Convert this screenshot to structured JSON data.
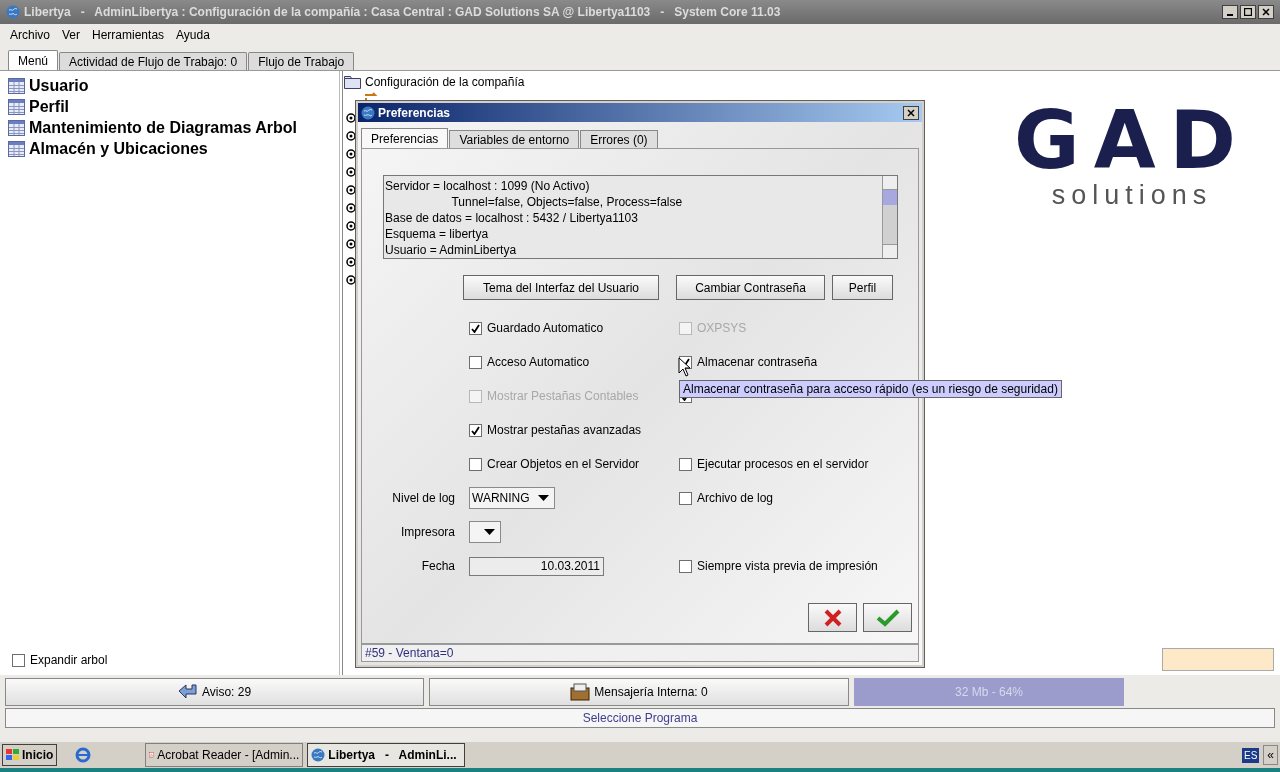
{
  "window": {
    "title": "Libertya   -   AdminLibertya : Configuración de la compañía : Casa Central : GAD Solutions SA @ Libertya1103   -   System Core 11.03"
  },
  "menu": [
    "Archivo",
    "Ver",
    "Herramientas",
    "Ayuda"
  ],
  "tabs": [
    {
      "label": "Menú",
      "selected": true
    },
    {
      "label": "Actividad de Flujo de Trabajo: 0",
      "selected": false
    },
    {
      "label": "Flujo de Trabajo",
      "selected": false
    }
  ],
  "sidebar": {
    "items": [
      "Usuario",
      "Perfil",
      "Mantenimiento de Diagramas Arbol",
      "Almacén y Ubicaciones"
    ],
    "expand": {
      "label": "Expandir arbol",
      "checked": false
    }
  },
  "tree": {
    "root": "Configuración de la compañía"
  },
  "logo": {
    "mark": "GAD",
    "tagline": "solutions"
  },
  "dialog": {
    "title": "Preferencias",
    "tabs": [
      {
        "label": "Preferencias",
        "selected": true
      },
      {
        "label": "Variables de entorno",
        "selected": false
      },
      {
        "label": "Errores (0)",
        "selected": false
      }
    ],
    "info_lines": [
      "Servidor = localhost : 1099 (No Activo)",
      "                    Tunnel=false, Objects=false, Process=false",
      "Base de datos = localhost : 5432 / Libertya1103",
      "Esquema = libertya",
      "Usuario = AdminLibertya"
    ],
    "buttons": [
      "Tema del Interfaz del Usuario",
      "Cambiar Contraseña",
      "Perfil"
    ],
    "rows": [
      {
        "left": {
          "kind": "checkbox",
          "label": "Guardado Automatico",
          "checked": true,
          "disabled": false
        },
        "right": {
          "kind": "checkbox",
          "label": "OXPSYS",
          "checked": false,
          "disabled": true
        }
      },
      {
        "left": {
          "kind": "checkbox",
          "label": "Acceso Automatico",
          "checked": false,
          "disabled": false
        },
        "right": {
          "kind": "checkbox",
          "label": "Almacenar contraseña",
          "checked": true,
          "disabled": false
        }
      },
      {
        "left": {
          "kind": "checkbox",
          "label": "Mostrar Pestañas Contables",
          "checked": false,
          "disabled": true
        },
        "right": {
          "kind": "covered",
          "checked": true
        }
      },
      {
        "left": {
          "kind": "checkbox",
          "label": "Mostrar pestañas avanzadas",
          "checked": true,
          "disabled": false
        }
      },
      {
        "left": {
          "kind": "checkbox",
          "label": "Crear Objetos en el Servidor",
          "checked": false,
          "disabled": false
        },
        "right": {
          "kind": "checkbox",
          "label": "Ejecutar procesos en el servidor",
          "checked": false,
          "disabled": false
        }
      },
      {
        "left": {
          "kind": "select",
          "label": "Nivel de log",
          "value": "WARNING"
        },
        "right": {
          "kind": "checkbox",
          "label": "Archivo de log",
          "checked": false,
          "disabled": false
        }
      },
      {
        "left": {
          "kind": "select",
          "label": "Impresora"
        }
      },
      {
        "left": {
          "kind": "field",
          "label": "Fecha",
          "value": "10.03.2011"
        },
        "right": {
          "kind": "checkbox",
          "label": "Siempre vista previa de impresión",
          "checked": false,
          "disabled": false
        }
      }
    ],
    "tooltip": "Almacenar contraseña para acceso rápido (es un riesgo de seguridad)",
    "status": "#59 - Ventana=0"
  },
  "status_bar": {
    "notices": "Aviso: 29",
    "messages": "Mensajería Interna: 0",
    "memory": "32 Mb - 64%",
    "hint": "Seleccione Programa"
  },
  "taskbar": {
    "start": "Inicio",
    "tasks": [
      {
        "label": "Acrobat Reader - [Admin...",
        "selected": false
      },
      {
        "label": "Libertya   -   AdminLi...",
        "selected": true
      }
    ],
    "lang": "ES",
    "tray": "«"
  }
}
